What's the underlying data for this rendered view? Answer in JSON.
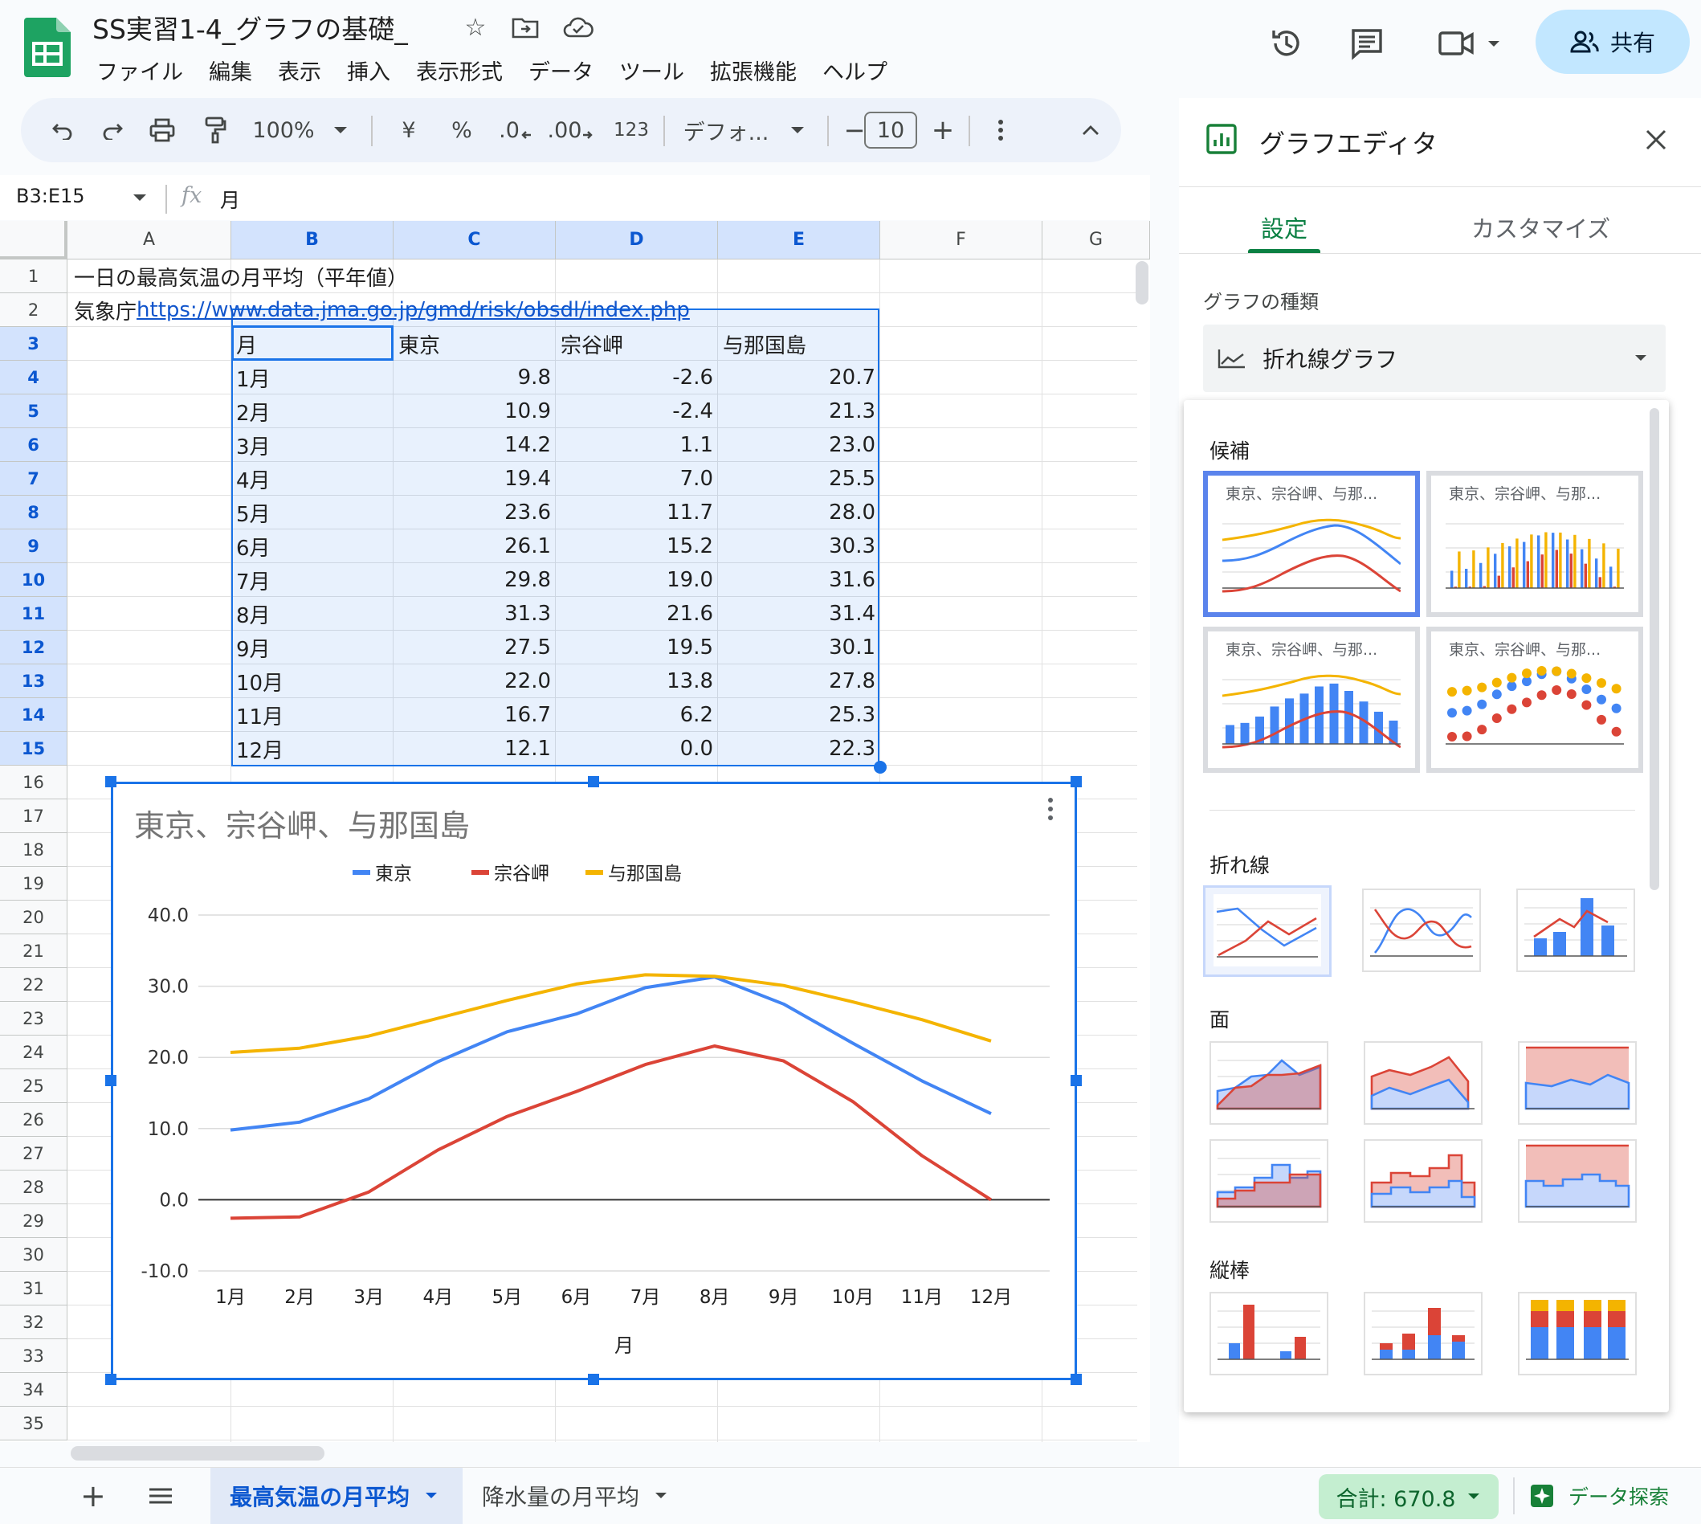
{
  "header": {
    "doc_title": "SS実習1-4_グラフの基礎_",
    "menu": [
      "ファイル",
      "編集",
      "表示",
      "挿入",
      "表示形式",
      "データ",
      "ツール",
      "拡張機能",
      "ヘルプ"
    ],
    "share_label": "共有"
  },
  "toolbar": {
    "zoom": "100%",
    "currency": "¥",
    "percent": "%",
    "decrease_decimal": ".0",
    "increase_decimal": ".00",
    "number_format": "123",
    "font_name": "デフォ...",
    "font_size": "10",
    "minus": "−",
    "plus": "+"
  },
  "formula_bar": {
    "range": "B3:E15",
    "fx": "fx",
    "content": "月"
  },
  "grid": {
    "columns": [
      "A",
      "B",
      "C",
      "D",
      "E",
      "F",
      "G"
    ],
    "rows": [
      "1",
      "2",
      "3",
      "4",
      "5",
      "6",
      "7",
      "8",
      "9",
      "10",
      "11",
      "12",
      "13",
      "14",
      "15",
      "16",
      "17",
      "18",
      "19",
      "20",
      "21",
      "22",
      "23",
      "24",
      "25",
      "26",
      "27",
      "28",
      "29",
      "30",
      "31",
      "32",
      "33",
      "34",
      "35"
    ],
    "a1": "一日の最高気温の月平均（平年値）",
    "a2_text": "気象庁 ",
    "a2_link": "https://www.data.jma.go.jp/gmd/risk/obsdl/index.php",
    "table_header": [
      "月",
      "東京",
      "宗谷岬",
      "与那国島"
    ],
    "table_rows": [
      [
        "1月",
        "9.8",
        "-2.6",
        "20.7"
      ],
      [
        "2月",
        "10.9",
        "-2.4",
        "21.3"
      ],
      [
        "3月",
        "14.2",
        "1.1",
        "23.0"
      ],
      [
        "4月",
        "19.4",
        "7.0",
        "25.5"
      ],
      [
        "5月",
        "23.6",
        "11.7",
        "28.0"
      ],
      [
        "6月",
        "26.1",
        "15.2",
        "30.3"
      ],
      [
        "7月",
        "29.8",
        "19.0",
        "31.6"
      ],
      [
        "8月",
        "31.3",
        "21.6",
        "31.4"
      ],
      [
        "9月",
        "27.5",
        "19.5",
        "30.1"
      ],
      [
        "10月",
        "22.0",
        "13.8",
        "27.8"
      ],
      [
        "11月",
        "16.7",
        "6.2",
        "25.3"
      ],
      [
        "12月",
        "12.1",
        "0.0",
        "22.3"
      ]
    ]
  },
  "chart_data": {
    "type": "line",
    "title": "東京、宗谷岬、与那国島",
    "xlabel": "月",
    "ylabel": "",
    "categories": [
      "1月",
      "2月",
      "3月",
      "4月",
      "5月",
      "6月",
      "7月",
      "8月",
      "9月",
      "10月",
      "11月",
      "12月"
    ],
    "series": [
      {
        "name": "東京",
        "color": "#4285f4",
        "values": [
          9.8,
          10.9,
          14.2,
          19.4,
          23.6,
          26.1,
          29.8,
          31.3,
          27.5,
          22.0,
          16.7,
          12.1
        ]
      },
      {
        "name": "宗谷岬",
        "color": "#db4437",
        "values": [
          -2.6,
          -2.4,
          1.1,
          7.0,
          11.7,
          15.2,
          19.0,
          21.6,
          19.5,
          13.8,
          6.2,
          0.0
        ]
      },
      {
        "name": "与那国島",
        "color": "#f4b400",
        "values": [
          20.7,
          21.3,
          23.0,
          25.5,
          28.0,
          30.3,
          31.6,
          31.4,
          30.1,
          27.8,
          25.3,
          22.3
        ]
      }
    ],
    "ylim": [
      -10,
      40
    ],
    "yticks": [
      "40.0",
      "30.0",
      "20.0",
      "10.0",
      "0.0",
      "-10.0"
    ],
    "grid": true,
    "legend": "top"
  },
  "sheets": {
    "tabs": [
      "最高気温の月平均",
      "降水量の月平均"
    ],
    "active": "最高気温の月平均"
  },
  "status": {
    "sum": "合計: 670.8",
    "explore": "データ探索"
  },
  "panel": {
    "title": "グラフエディタ",
    "tabs": [
      "設定",
      "カスタマイズ"
    ],
    "chart_type_label": "グラフの種類",
    "chart_type_value": "折れ線グラフ",
    "sections": {
      "suggested": "候補",
      "line": "折れ線",
      "area": "面",
      "column": "縦棒"
    },
    "suggestion_title": "東京、宗谷岬、与那...",
    "colors": {
      "accent_green": "#0b8043",
      "selected_blue": "#5b84ec"
    }
  }
}
